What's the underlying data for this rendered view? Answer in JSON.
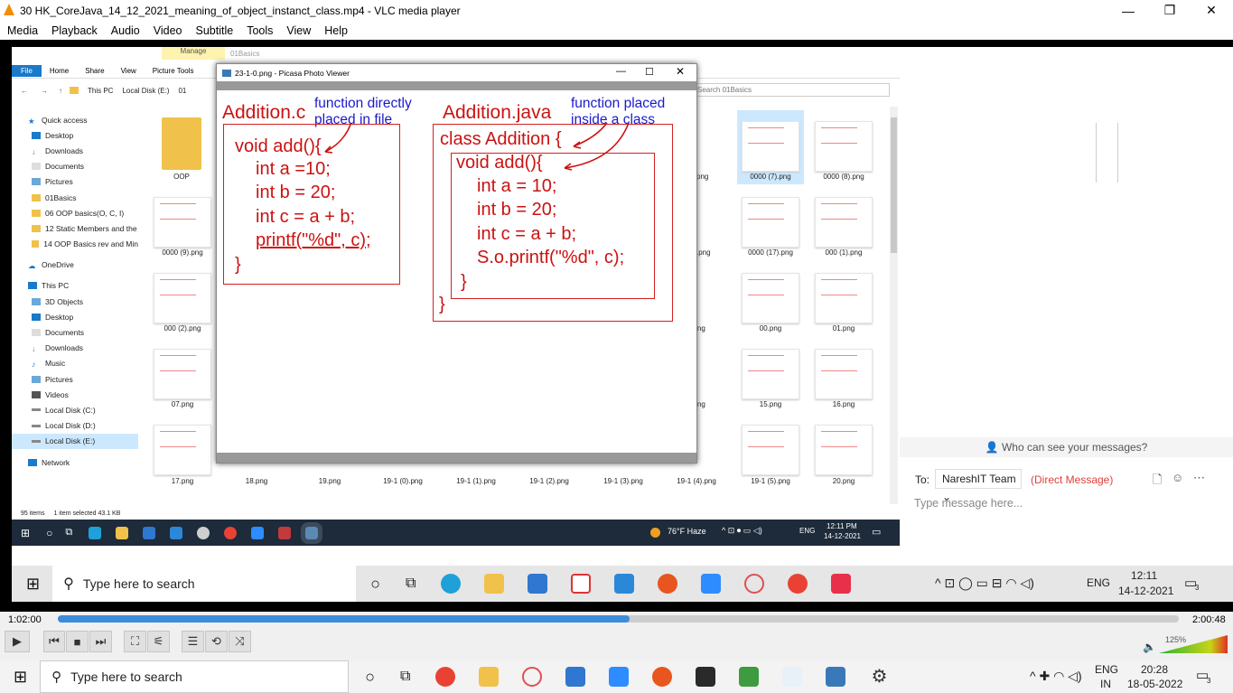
{
  "vlc": {
    "title": "30 HK_CoreJava_14_12_2021_meaning_of_object_instanct_class.mp4 - VLC media player",
    "menu": [
      "Media",
      "Playback",
      "Audio",
      "Video",
      "Subtitle",
      "Tools",
      "View",
      "Help"
    ],
    "time_elapsed": "1:02:00",
    "time_total": "2:00:48",
    "progress_fraction": 0.51,
    "volume_label": "125%"
  },
  "explorer": {
    "ribbon_manage": "Manage",
    "ribbon_folder": "01Basics",
    "tabs": [
      "File",
      "Home",
      "Share",
      "View",
      "Picture Tools"
    ],
    "breadcrumb": [
      "This PC",
      "Local Disk (E:)",
      "01"
    ],
    "search_placeholder": "Search 01Basics",
    "nav": [
      "Quick access",
      "Desktop",
      "Downloads",
      "Documents",
      "Pictures",
      "01Basics",
      "06 OOP basics(O, C, I)",
      "12 Static Members and the",
      "14 OOP Basics rev and Min",
      "OneDrive",
      "This PC",
      "3D Objects",
      "Desktop",
      "Documents",
      "Downloads",
      "Music",
      "Pictures",
      "Videos",
      "Local Disk (C:)",
      "Local Disk (D:)",
      "Local Disk (E:)",
      "Network"
    ],
    "files": [
      "OOP",
      "6).png",
      "0000 (7).png",
      "0000 (8).png",
      "0000 (9).png",
      "16).png",
      "0000 (17).png",
      "000 (1).png",
      "000 (2).png",
      ".png",
      "00.png",
      "01.png",
      "07.png",
      ".png",
      "15.png",
      "16.png",
      "17.png",
      "18.png",
      "19.png",
      "19-1 (0).png",
      "19-1 (1).png",
      "19-1 (2).png",
      "19-1 (3).png",
      "19-1 (4).png",
      "19-1 (5).png",
      "20.png"
    ],
    "status_count": "95 items",
    "status_selected": "1 item selected  43.1 KB"
  },
  "picasa": {
    "title": "23-1-0.png - Picasa Photo Viewer",
    "left_title": "Addition.c",
    "left_note": [
      "function directly",
      "placed in file"
    ],
    "left_code": [
      "void add(){",
      "int a =10;",
      "int b = 20;",
      "int c = a + b;",
      "printf(\"%d\", c);",
      "}"
    ],
    "right_title": "Addition.java",
    "right_note": [
      "function placed",
      "inside a class"
    ],
    "right_code": [
      "class Addition {",
      "void add(){",
      "int a = 10;",
      "int b = 20;",
      "int c = a + b;",
      "S.o.printf(\"%d\", c);",
      "}",
      "}"
    ]
  },
  "inner_taskbar": {
    "weather": "76°F  Haze",
    "lang": "ENG",
    "time": "12:11 PM",
    "date": "14-12-2021"
  },
  "teams": {
    "who": "Who can see your messages?",
    "to_label": "To:",
    "recipient": "NareshIT Team",
    "direct": "(Direct Message)",
    "placeholder": "Type message here..."
  },
  "outer_taskbar": {
    "search": "Type here to search",
    "lang": "ENG",
    "time": "12:11",
    "date": "14-12-2021",
    "badge": "3"
  },
  "host_taskbar": {
    "search": "Type here to search",
    "lang": "ENG",
    "region": "IN",
    "time": "20:28",
    "date": "18-05-2022",
    "badge": "3"
  }
}
